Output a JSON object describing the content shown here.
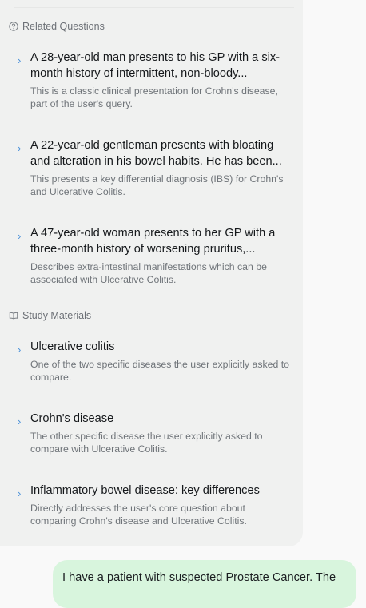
{
  "related": {
    "header": "Related Questions",
    "items": [
      {
        "title": "A 28-year-old man presents to his GP with a six-month history of intermittent, non-bloody...",
        "desc": "This is a classic clinical presentation for Crohn's disease, part of the user's query."
      },
      {
        "title": "A 22-year-old gentleman presents with bloating and alteration in his bowel habits. He has been...",
        "desc": "This presents a key differential diagnosis (IBS) for Crohn's and Ulcerative Colitis."
      },
      {
        "title": "A 47-year-old woman presents to her GP with a three-month history of worsening pruritus,...",
        "desc": "Describes extra-intestinal manifestations which can be associated with Ulcerative Colitis."
      }
    ]
  },
  "study": {
    "header": "Study Materials",
    "items": [
      {
        "title": "Ulcerative colitis",
        "desc": "One of the two specific diseases the user explicitly asked to compare."
      },
      {
        "title": "Crohn's disease",
        "desc": "The other specific disease the user explicitly asked to compare with Ulcerative Colitis."
      },
      {
        "title": "Inflammatory bowel disease: key differences",
        "desc": "Directly addresses the user's core question about comparing Crohn's disease and Ulcerative Colitis."
      }
    ]
  },
  "chevron": "›",
  "user_message": "I have a patient with suspected Prostate Cancer. The"
}
